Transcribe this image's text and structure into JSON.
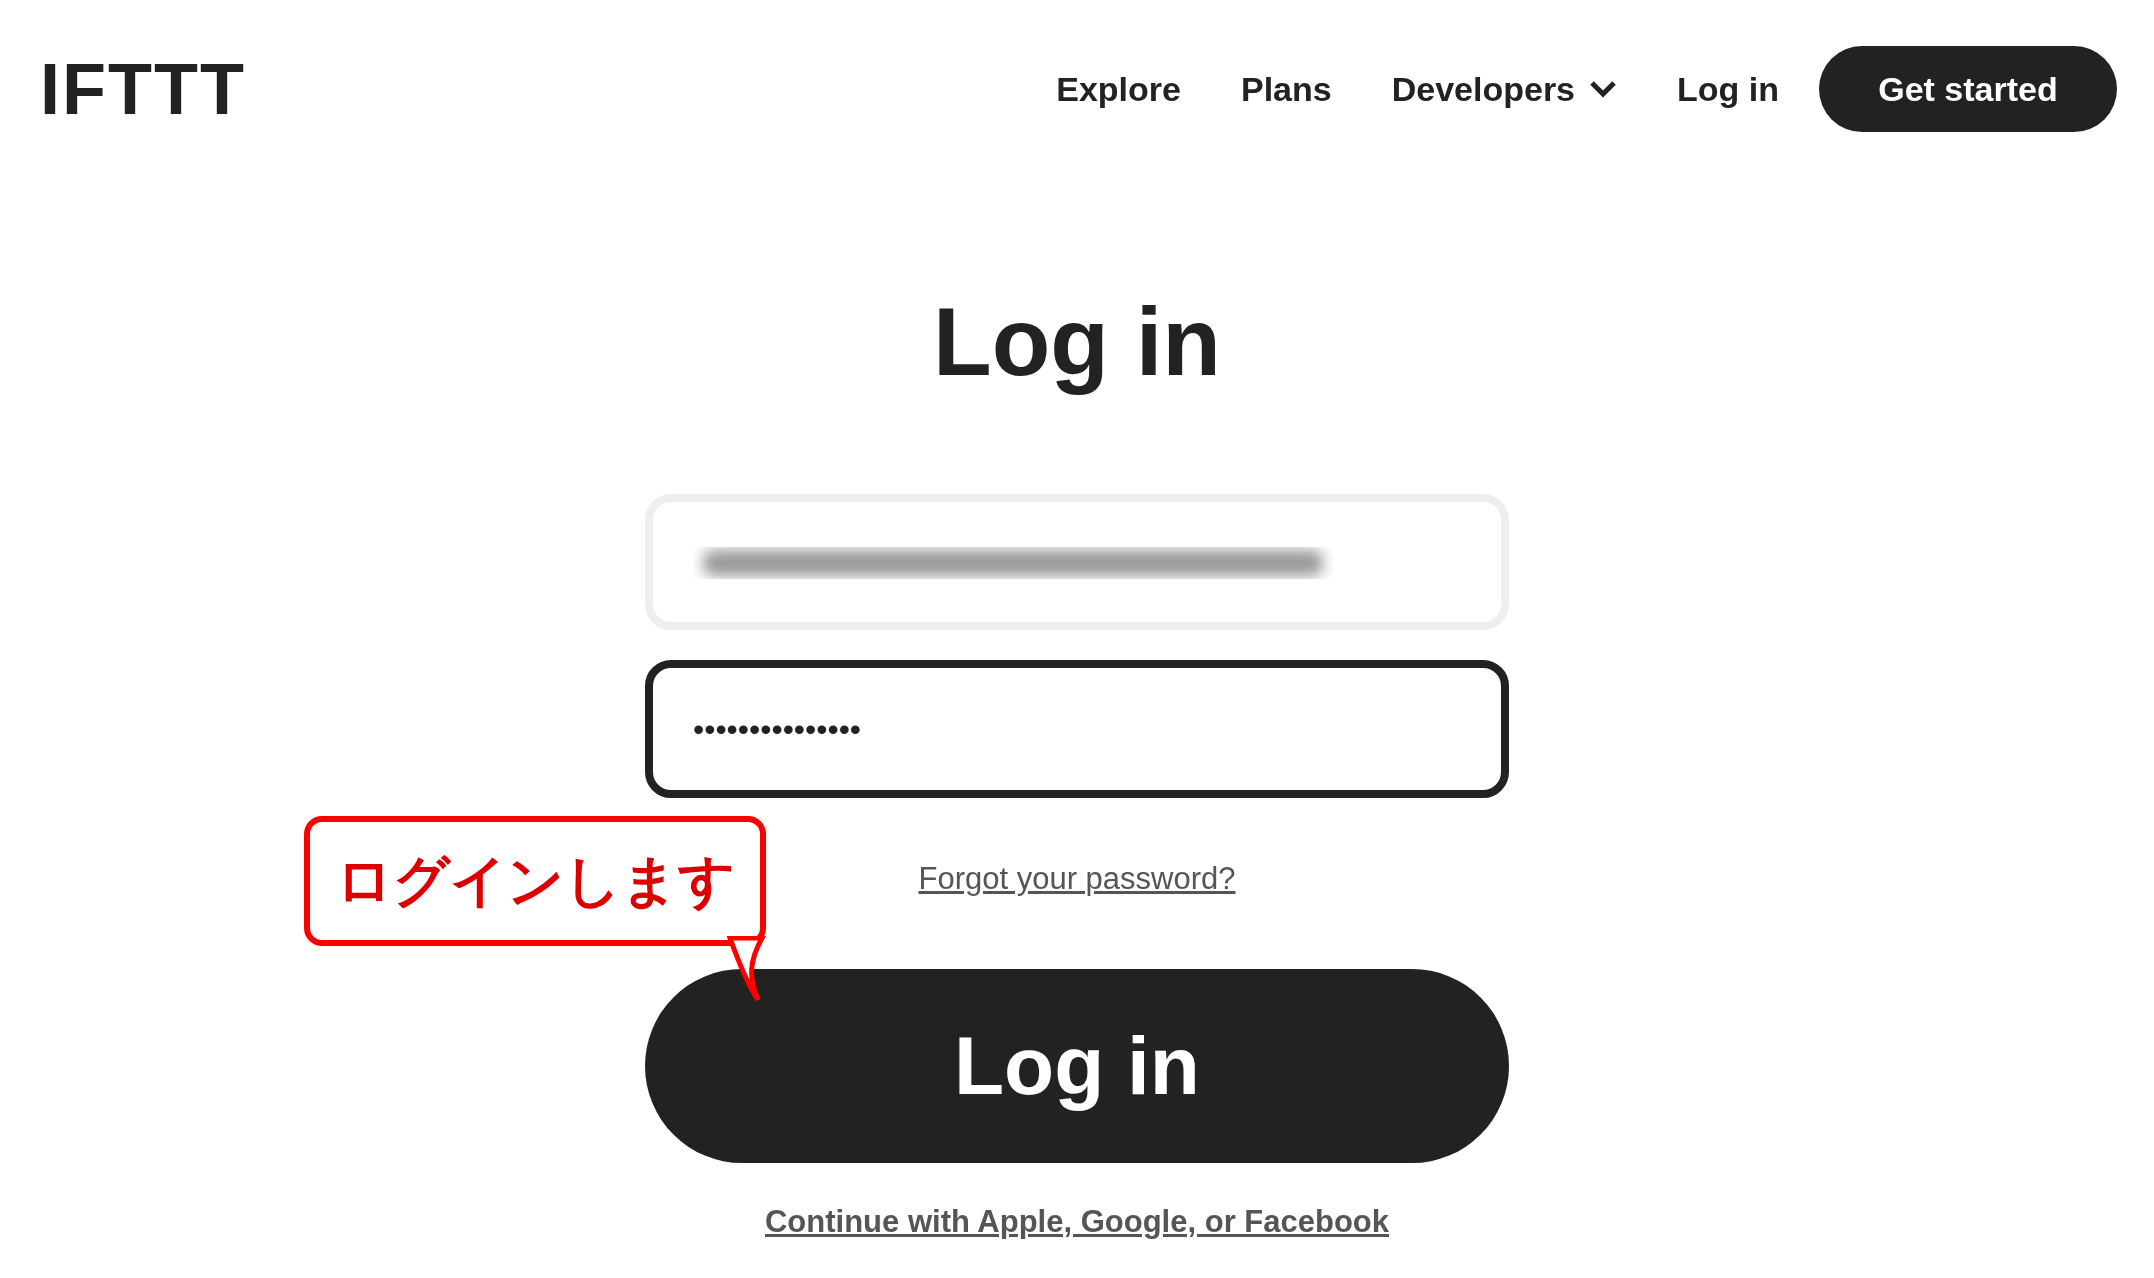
{
  "header": {
    "logo": "IFTTT",
    "nav": [
      {
        "label": "Explore",
        "kind": "link"
      },
      {
        "label": "Plans",
        "kind": "link"
      },
      {
        "label": "Developers",
        "kind": "dropdown"
      },
      {
        "label": "Log in",
        "kind": "link"
      }
    ],
    "cta": "Get started"
  },
  "title": "Log in",
  "email_field": {
    "focused": false
  },
  "password_field": {
    "value": "•••••••••••••••",
    "focused": true
  },
  "forgot_link": "Forgot your password?",
  "login_button": "Log in",
  "social_link": "Continue with Apple, Google, or Facebook",
  "callout": {
    "text": "ログインします"
  }
}
